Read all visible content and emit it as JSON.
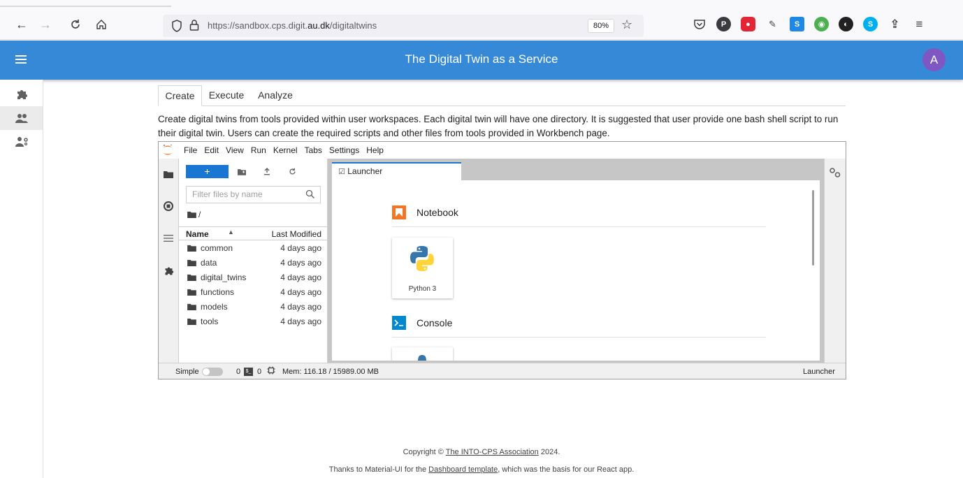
{
  "browser": {
    "url_prefix": "https://sandbox.cps.digit.",
    "url_domain": "au.dk",
    "url_path": "/digitaltwins",
    "zoom": "80%"
  },
  "header": {
    "title": "The Digital Twin as a Service",
    "avatar_initial": "A"
  },
  "tabs": [
    {
      "label": "Create",
      "active": true
    },
    {
      "label": "Execute",
      "active": false
    },
    {
      "label": "Analyze",
      "active": false
    }
  ],
  "description": "Create digital twins from tools provided within user workspaces. Each digital twin will have one directory. It is suggested that user provide one bash shell script to run their digital twin. Users can create the required scripts and other files from tools provided in Workbench page.",
  "jupyter": {
    "menu": [
      "File",
      "Edit",
      "View",
      "Run",
      "Kernel",
      "Tabs",
      "Settings",
      "Help"
    ],
    "new_label": "+",
    "filter_placeholder": "Filter files by name",
    "breadcrumb": "/",
    "col_name": "Name",
    "col_modified": "Last Modified",
    "files": [
      {
        "name": "common",
        "modified": "4 days ago"
      },
      {
        "name": "data",
        "modified": "4 days ago"
      },
      {
        "name": "digital_twins",
        "modified": "4 days ago"
      },
      {
        "name": "functions",
        "modified": "4 days ago"
      },
      {
        "name": "models",
        "modified": "4 days ago"
      },
      {
        "name": "tools",
        "modified": "4 days ago"
      }
    ],
    "dock_tab": "Launcher",
    "section_notebook": "Notebook",
    "kernel_label": "Python 3",
    "section_console": "Console",
    "status": {
      "simple": "Simple",
      "kernels": "0",
      "terminals": "0",
      "term_badge": "$_",
      "mem": "Mem: 116.18 / 15989.00 MB",
      "right": "Launcher"
    }
  },
  "footer": {
    "copyright_prefix": "Copyright © ",
    "copyright_link": "The INTO-CPS Association",
    "copyright_suffix": " 2024.",
    "thanks_prefix": "Thanks to Material-UI for the ",
    "thanks_link": "Dashboard template",
    "thanks_suffix": ", which was the basis for our React app."
  },
  "colors": {
    "app_bar": "#3689d6",
    "avatar": "#7e57c2",
    "jupyter_blue": "#1976d2",
    "notebook_orange": "#f37626"
  }
}
